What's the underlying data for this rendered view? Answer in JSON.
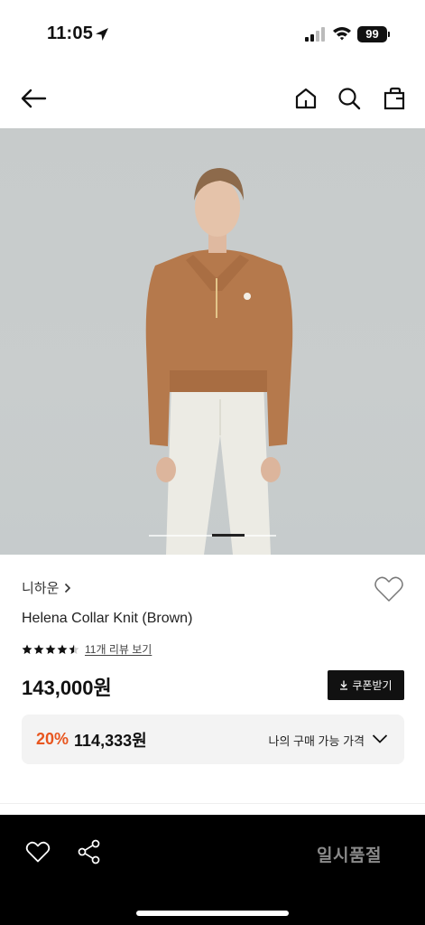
{
  "status_bar": {
    "time": "11:05",
    "battery": "99"
  },
  "nav": {
    "icons": [
      "arrow-left-icon",
      "home-icon",
      "search-icon",
      "shopping-bag-icon"
    ]
  },
  "gallery": {
    "image_description_hidden": "",
    "current_index": 2,
    "total": 3
  },
  "product": {
    "brand": "니하운",
    "name": "Helena Collar Knit (Brown)",
    "rating": 4.5,
    "review_link": "11개 리뷰 보기",
    "price": "143,000원",
    "coupon_label": "쿠폰받기",
    "discount_rate": "20%",
    "discount_price": "114,333원",
    "my_price_label": "나의 구매 가능 가격"
  },
  "bottom_bar": {
    "soldout_label": "일시품절"
  },
  "colors": {
    "accent_discount": "#e8561f",
    "bottom_bar_bg": "#000000",
    "coupon_bg": "#111111"
  }
}
